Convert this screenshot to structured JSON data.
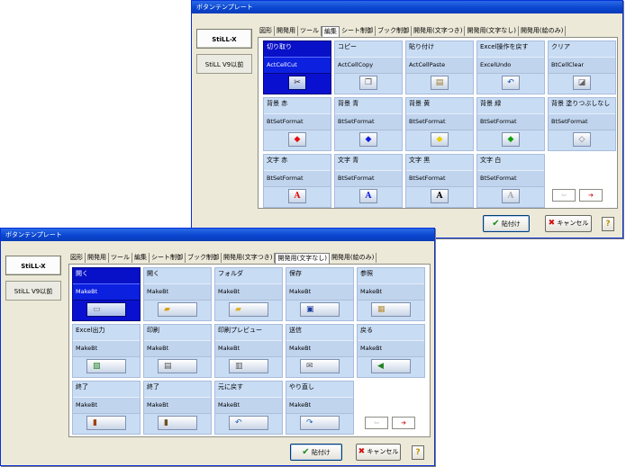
{
  "colors": {
    "title_bar": "#0a46d0",
    "selected_cell": "#0a10d0",
    "cell_bg": "#c8dcf4",
    "check": "#1f8a1f",
    "cross": "#d01010",
    "arrow": "#d01010"
  },
  "dialogs": [
    {
      "title": "ボタンテンプレート",
      "sidebar": [
        "StiLL-X",
        "StiLL V9以前"
      ],
      "tabs": [
        "図形",
        "開発用",
        "ツール",
        "編集",
        "シート制御",
        "ブック制御",
        "開発用(文字つき)",
        "開発用(文字なし)",
        "開発用(絵のみ)"
      ],
      "selected_tab": "編集",
      "cells": [
        {
          "name": "切り取り",
          "macro": "ActCellCut",
          "icon": "scissors-icon",
          "glyph": "✂",
          "color": "#222222",
          "selected": true
        },
        {
          "name": "コピー",
          "macro": "ActCellCopy",
          "icon": "copy-icon",
          "glyph": "❐",
          "color": "#555555"
        },
        {
          "name": "貼り付け",
          "macro": "ActCellPaste",
          "icon": "paste-icon",
          "glyph": "▤",
          "color": "#9a7a30"
        },
        {
          "name": "Excel操作を戻す",
          "macro": "ExcelUndo",
          "icon": "undo-icon",
          "glyph": "↶",
          "color": "#1050c0"
        },
        {
          "name": "クリア",
          "macro": "BtCellClear",
          "icon": "eraser-icon",
          "glyph": "◪",
          "color": "#666666"
        },
        {
          "name": "背景 赤",
          "macro": "BtSetFormat",
          "icon": "fill-red-icon",
          "glyph": "◆",
          "color": "#e01010"
        },
        {
          "name": "背景 青",
          "macro": "BtSetFormat",
          "icon": "fill-blue-icon",
          "glyph": "◆",
          "color": "#1020e0"
        },
        {
          "name": "背景 黄",
          "macro": "BtSetFormat",
          "icon": "fill-yellow-icon",
          "glyph": "◆",
          "color": "#e8d000"
        },
        {
          "name": "背景 緑",
          "macro": "BtSetFormat",
          "icon": "fill-green-icon",
          "glyph": "◆",
          "color": "#10a010"
        },
        {
          "name": "背景 塗りつぶしなし",
          "macro": "BtSetFormat",
          "icon": "fill-none-icon",
          "glyph": "◇",
          "color": "#777777"
        },
        {
          "name": "文字 赤",
          "macro": "BtSetFormat",
          "icon": "font-red-icon",
          "glyph": "A",
          "color": "#e01010"
        },
        {
          "name": "文字 青",
          "macro": "BtSetFormat",
          "icon": "font-blue-icon",
          "glyph": "A",
          "color": "#1020e0"
        },
        {
          "name": "文字 黒",
          "macro": "BtSetFormat",
          "icon": "font-black-icon",
          "glyph": "A",
          "color": "#000000"
        },
        {
          "name": "文字 白",
          "macro": "BtSetFormat",
          "icon": "font-white-icon",
          "glyph": "A",
          "color": "#aaaaaa"
        }
      ],
      "paste_label": "貼付け",
      "cancel_label": "キャンセル",
      "help_label": "?",
      "prev_arrow": "⇦",
      "next_arrow": "➔"
    },
    {
      "title": "ボタンテンプレート",
      "sidebar": [
        "StiLL-X",
        "StiLL V9以前"
      ],
      "tabs": [
        "図形",
        "開発用",
        "ツール",
        "編集",
        "シート制御",
        "ブック制御",
        "開発用(文字つき)",
        "開発用(文字なし)",
        "開発用(絵のみ)"
      ],
      "selected_tab": "開発用(文字なし)",
      "cells": [
        {
          "name": "開く",
          "macro": "MakeBt",
          "icon": "open-icon",
          "glyph": "▭",
          "color": "#777777",
          "selected": true
        },
        {
          "name": "開く",
          "macro": "MakeBt",
          "icon": "open-folder-icon",
          "glyph": "▰",
          "color": "#d8a020"
        },
        {
          "name": "フォルダ",
          "macro": "MakeBt",
          "icon": "folder-icon",
          "glyph": "▰",
          "color": "#e0b030"
        },
        {
          "name": "保存",
          "macro": "MakeBt",
          "icon": "save-icon",
          "glyph": "▣",
          "color": "#2040a0"
        },
        {
          "name": "参照",
          "macro": "MakeBt",
          "icon": "browse-icon",
          "glyph": "▦",
          "color": "#b89040"
        },
        {
          "name": "Excel出力",
          "macro": "MakeBt",
          "icon": "excel-export-icon",
          "glyph": "▧",
          "color": "#208020"
        },
        {
          "name": "印刷",
          "macro": "MakeBt",
          "icon": "print-icon",
          "glyph": "▤",
          "color": "#555555"
        },
        {
          "name": "印刷プレビュー",
          "macro": "MakeBt",
          "icon": "print-preview-icon",
          "glyph": "▥",
          "color": "#555555"
        },
        {
          "name": "送信",
          "macro": "MakeBt",
          "icon": "send-icon",
          "glyph": "✉",
          "color": "#555555"
        },
        {
          "name": "戻る",
          "macro": "MakeBt",
          "icon": "back-arrow-icon",
          "glyph": "◀",
          "color": "#208020"
        },
        {
          "name": "終了",
          "macro": "MakeBt",
          "icon": "exit-door-icon",
          "glyph": "▮",
          "color": "#a04010"
        },
        {
          "name": "終了",
          "macro": "MakeBt",
          "icon": "exit-icon",
          "glyph": "▮",
          "color": "#705020"
        },
        {
          "name": "元に戻す",
          "macro": "MakeBt",
          "icon": "undo-icon",
          "glyph": "↶",
          "color": "#2060c0"
        },
        {
          "name": "やり直し",
          "macro": "MakeBt",
          "icon": "redo-icon",
          "glyph": "↷",
          "color": "#2060c0"
        }
      ],
      "paste_label": "貼付け",
      "cancel_label": "キャンセル",
      "help_label": "?",
      "prev_arrow": "⇦",
      "next_arrow": "➔"
    }
  ]
}
